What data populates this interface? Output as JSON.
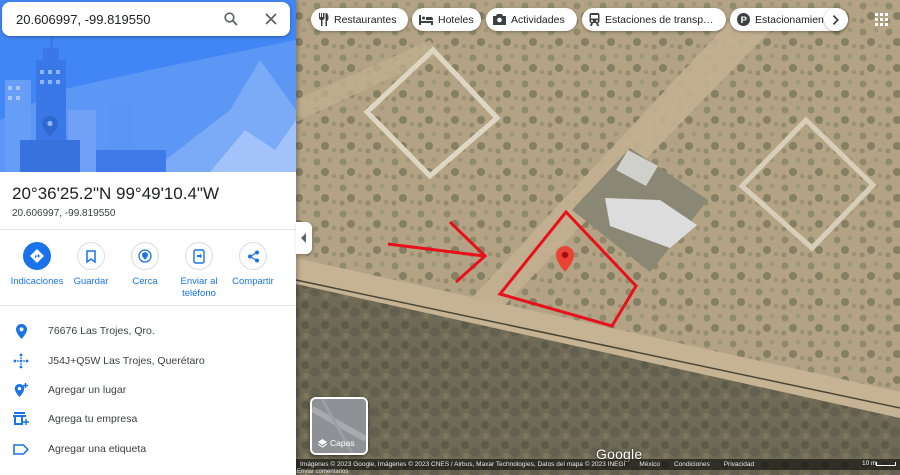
{
  "search": {
    "query": "20.606997, -99.819550"
  },
  "place": {
    "title": "20°36'25.2\"N 99°49'10.4\"W",
    "decimal": "20.606997, -99.819550"
  },
  "actions": [
    {
      "label": "Indicaciones",
      "icon": "directions-icon"
    },
    {
      "label": "Guardar",
      "icon": "bookmark-icon"
    },
    {
      "label": "Cerca",
      "icon": "nearby-icon"
    },
    {
      "label": "Enviar al teléfono",
      "icon": "send-to-phone-icon"
    },
    {
      "label": "Compartir",
      "icon": "share-icon"
    }
  ],
  "info": [
    {
      "text": "76676 Las Trojes, Qro.",
      "icon": "location-pin-icon"
    },
    {
      "text": "J54J+Q5W Las Trojes, Querétaro",
      "icon": "plus-code-icon"
    },
    {
      "text": "Agregar un lugar",
      "icon": "add-place-icon"
    },
    {
      "text": "Agrega tu empresa",
      "icon": "store-icon"
    },
    {
      "text": "Agregar una etiqueta",
      "icon": "label-icon"
    }
  ],
  "chips": [
    {
      "label": "Restaurantes",
      "icon": "restaurant-icon"
    },
    {
      "label": "Hoteles",
      "icon": "hotel-icon"
    },
    {
      "label": "Actividades",
      "icon": "camera-icon"
    },
    {
      "label": "Estaciones de transp…",
      "icon": "transit-icon"
    },
    {
      "label": "Estacionamien",
      "icon": "parking-icon"
    }
  ],
  "layers": {
    "label": "Capas"
  },
  "logo": "Google",
  "footer": {
    "attribution": "Imágenes © 2023 Google, Imágenes © 2023 CNES / Airbus, Maxar Technologies, Datos del mapa © 2023 INEGI",
    "country": "México",
    "terms": "Condiciones",
    "privacy": "Privacidad",
    "feedback": "Enviar comentarios",
    "scale": "10 m"
  },
  "colors": {
    "accent": "#1a73e8",
    "marker": "#ea4335",
    "annotation": "#e8101a",
    "hero": "#4285f4"
  }
}
